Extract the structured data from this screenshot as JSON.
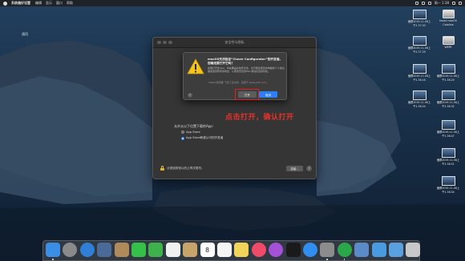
{
  "menubar": {
    "app_name": "系统偏好设置",
    "items": [
      "编辑",
      "显示",
      "窗口",
      "帮助"
    ],
    "clock": "周一 1:38"
  },
  "prefs_window": {
    "title": "安全性与隐私",
    "general_label": "通用",
    "allow_label": "允许从以下位置下载的App:",
    "options": [
      "App Store",
      "App Store和被认可的开发者"
    ],
    "selected_option": 1,
    "lock_text": "点按锁按钮以防止再次更改。",
    "advanced_label": "高级...",
    "help_label": "?"
  },
  "alert": {
    "title": "macOS无法验证“Clover Configurator”的开发者。您确定要打开它吗？",
    "body": "如果打开此App，将会覆盖系统安全性，这可能会使您的电脑和个人信息遭受恶意软件的攻击，从而危害您的Mac或侵犯您的隐私。",
    "subtext": "“Safari浏览器”下载了此文件，来源于 www.pc6.com 。",
    "open_label": "打开",
    "cancel_label": "取消",
    "help_label": "?"
  },
  "annotation": "点击打开，确认打开",
  "desktop_icons": [
    {
      "caption_1": "截屏2019-11-08上",
      "caption_2": "午1.37.03"
    },
    {
      "caption_1": "截屏2019-11-08上",
      "caption_2": "午1.37.29"
    },
    {
      "caption_1": "截屏2019-11-08上",
      "caption_2": "午1.38.16"
    },
    {
      "caption_1": "截屏2019-11-08上",
      "caption_2": "午1.38.20"
    },
    {
      "caption_1": "截屏2019-11-08上",
      "caption_2": "午1.38.24"
    },
    {
      "caption_1": "截屏2019-11-08上",
      "caption_2": "午1.38.32"
    },
    {
      "caption_1": "截屏2019-11-08上",
      "caption_2": "午1.38.47"
    },
    {
      "caption_1": "截屏2019-11-08上",
      "caption_2": "午1.38.51"
    },
    {
      "caption_1": "截屏2019-11-08上",
      "caption_2": "午1.38.54"
    }
  ],
  "drive_icons": [
    {
      "caption_1": "Install macOS",
      "caption_2": "Catalina"
    },
    {
      "caption_1": "WEPE",
      "caption_2": ""
    }
  ],
  "dock_icons": [
    {
      "name": "finder-icon",
      "color": "#3b8ee8"
    },
    {
      "name": "launchpad-icon",
      "color": "#8a8a8a"
    },
    {
      "name": "safari-icon",
      "color": "#2f7fd8"
    },
    {
      "name": "photos-app-icon",
      "color": "#4a6a9a"
    },
    {
      "name": "contacts-icon",
      "color": "#b08a5a"
    },
    {
      "name": "messages-icon",
      "color": "#35c04a"
    },
    {
      "name": "facetime-icon",
      "color": "#3db14c"
    },
    {
      "name": "photos-icon",
      "color": "#f0f0f0"
    },
    {
      "name": "notes-contacts-icon",
      "color": "#c9a46a"
    },
    {
      "name": "calendar-icon",
      "color": "#ffffff"
    },
    {
      "name": "reminders-icon",
      "color": "#f5f5f5"
    },
    {
      "name": "notes-icon",
      "color": "#f2d45a"
    },
    {
      "name": "music-icon",
      "color": "#f04a6a"
    },
    {
      "name": "podcasts-icon",
      "color": "#a451d6"
    },
    {
      "name": "apple-tv-icon",
      "color": "#1a1a1a"
    },
    {
      "name": "app-store-icon",
      "color": "#2f8ef0"
    },
    {
      "name": "system-preferences-icon",
      "color": "#8c8c8c"
    },
    {
      "name": "clover-icon",
      "color": "#2aa84a"
    },
    {
      "name": "preview-icon",
      "color": "#5a8ac8"
    },
    {
      "name": "downloads-folder-icon",
      "color": "#4a9ae0"
    },
    {
      "name": "documents-folder-icon",
      "color": "#5aa0e0"
    },
    {
      "name": "trash-icon",
      "color": "#c8c8c8"
    }
  ],
  "calendar_day": "8"
}
